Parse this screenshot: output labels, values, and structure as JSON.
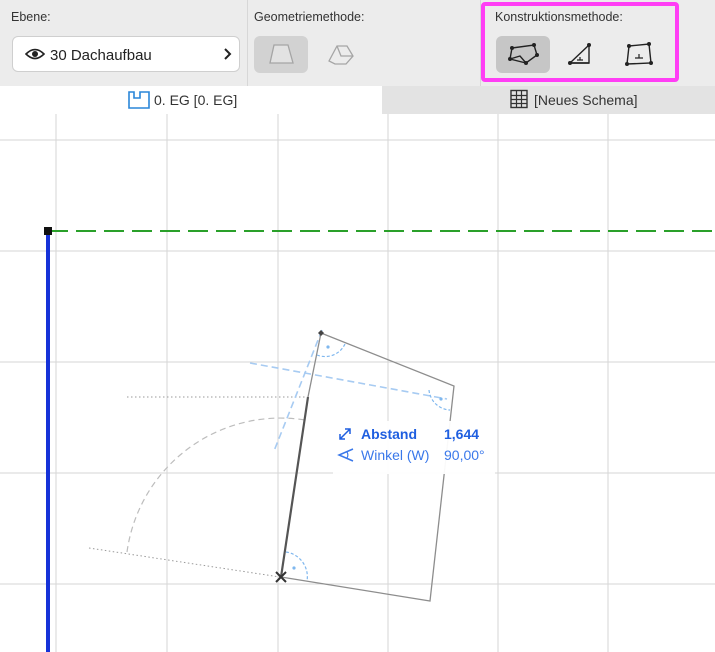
{
  "toolbar": {
    "layer": {
      "label": "Ebene:",
      "value": "30 Dachaufbau",
      "icon": "eye-icon"
    },
    "geometry": {
      "label": "Geometriemethode:",
      "buttons": [
        {
          "name": "geometry-polygon-icon",
          "state": "disabled-selected"
        },
        {
          "name": "geometry-box-icon",
          "state": "disabled"
        }
      ]
    },
    "construction": {
      "label": "Konstruktionsmethode:",
      "buttons": [
        {
          "name": "construction-polygon-icon",
          "state": "selected"
        },
        {
          "name": "construction-rotated-rectangle-icon",
          "state": "normal"
        },
        {
          "name": "construction-rectangle-icon",
          "state": "normal"
        }
      ],
      "highlight_color": "#ff3ef5"
    }
  },
  "tabs": [
    {
      "label": "0. EG [0. EG]",
      "icon": "floor-plan-icon",
      "active": true
    },
    {
      "label": "[Neues Schema]",
      "icon": "schedule-table-icon",
      "active": false
    }
  ],
  "tracker": {
    "rows": [
      {
        "label": "Abstand",
        "value": "1,644",
        "icon": "distance-icon"
      },
      {
        "label": "Winkel (W)",
        "value": "90,00°",
        "icon": "angle-icon"
      }
    ]
  },
  "colors": {
    "accent": "#1f5fe0",
    "wall": "#1632d8",
    "reference_line": "#2aa02a",
    "grid": "#d6d6d6"
  }
}
